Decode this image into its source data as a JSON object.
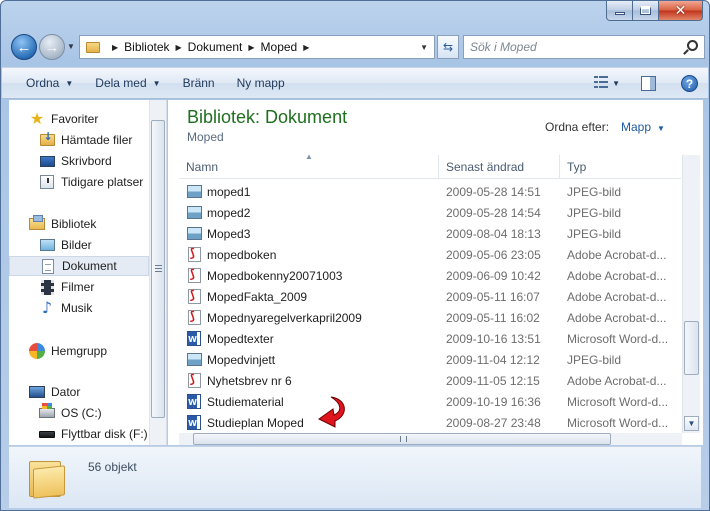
{
  "window": {
    "close_glyph": "✕"
  },
  "address": {
    "crumbs": [
      "Bibliotek",
      "Dokument",
      "Moped"
    ],
    "search_placeholder": "Sök i Moped"
  },
  "toolbar": {
    "organize": "Ordna",
    "share": "Dela med",
    "burn": "Bränn",
    "new_folder": "Ny mapp",
    "help": "?"
  },
  "navpane": {
    "favorites": "Favoriter",
    "downloads": "Hämtade filer",
    "desktop": "Skrivbord",
    "recent": "Tidigare platser",
    "libraries": "Bibliotek",
    "pictures": "Bilder",
    "documents": "Dokument",
    "videos": "Filmer",
    "music": "Musik",
    "homegroup": "Hemgrupp",
    "computer": "Dator",
    "os_drive": "OS (C:)",
    "removable": "Flyttbar disk (F:)"
  },
  "main": {
    "title": "Bibliotek: Dokument",
    "subtitle": "Moped",
    "arrange_label": "Ordna efter:",
    "arrange_value": "Mapp",
    "columns": {
      "name": "Namn",
      "date": "Senast ändrad",
      "type": "Typ"
    },
    "files": [
      {
        "name": "moped1",
        "date": "2009-05-28 14:51",
        "type": "JPEG-bild",
        "icon": "jpg"
      },
      {
        "name": "moped2",
        "date": "2009-05-28 14:54",
        "type": "JPEG-bild",
        "icon": "jpg"
      },
      {
        "name": "Moped3",
        "date": "2009-08-04 18:13",
        "type": "JPEG-bild",
        "icon": "jpg"
      },
      {
        "name": "mopedboken",
        "date": "2009-05-06 23:05",
        "type": "Adobe Acrobat-d...",
        "icon": "pdf"
      },
      {
        "name": "Mopedbokenny20071003",
        "date": "2009-06-09 10:42",
        "type": "Adobe Acrobat-d...",
        "icon": "pdf"
      },
      {
        "name": "MopedFakta_2009",
        "date": "2009-05-11 16:07",
        "type": "Adobe Acrobat-d...",
        "icon": "pdf"
      },
      {
        "name": "Mopednyaregelverkapril2009",
        "date": "2009-05-11 16:02",
        "type": "Adobe Acrobat-d...",
        "icon": "pdf"
      },
      {
        "name": "Mopedtexter",
        "date": "2009-10-16 13:51",
        "type": "Microsoft Word-d...",
        "icon": "word"
      },
      {
        "name": "Mopedvinjett",
        "date": "2009-11-04 12:12",
        "type": "JPEG-bild",
        "icon": "jpg"
      },
      {
        "name": "Nyhetsbrev nr 6",
        "date": "2009-11-05 12:15",
        "type": "Adobe Acrobat-d...",
        "icon": "pdf"
      },
      {
        "name": "Studiematerial",
        "date": "2009-10-19 16:36",
        "type": "Microsoft Word-d...",
        "icon": "word"
      },
      {
        "name": "Studieplan Moped",
        "date": "2009-08-27 23:48",
        "type": "Microsoft Word-d...",
        "icon": "word"
      }
    ]
  },
  "details": {
    "count": "56 objekt"
  },
  "colors": {
    "title_green": "#1e6f1e",
    "link_blue": "#1f5aa6",
    "annotation_red": "#e0141e"
  }
}
